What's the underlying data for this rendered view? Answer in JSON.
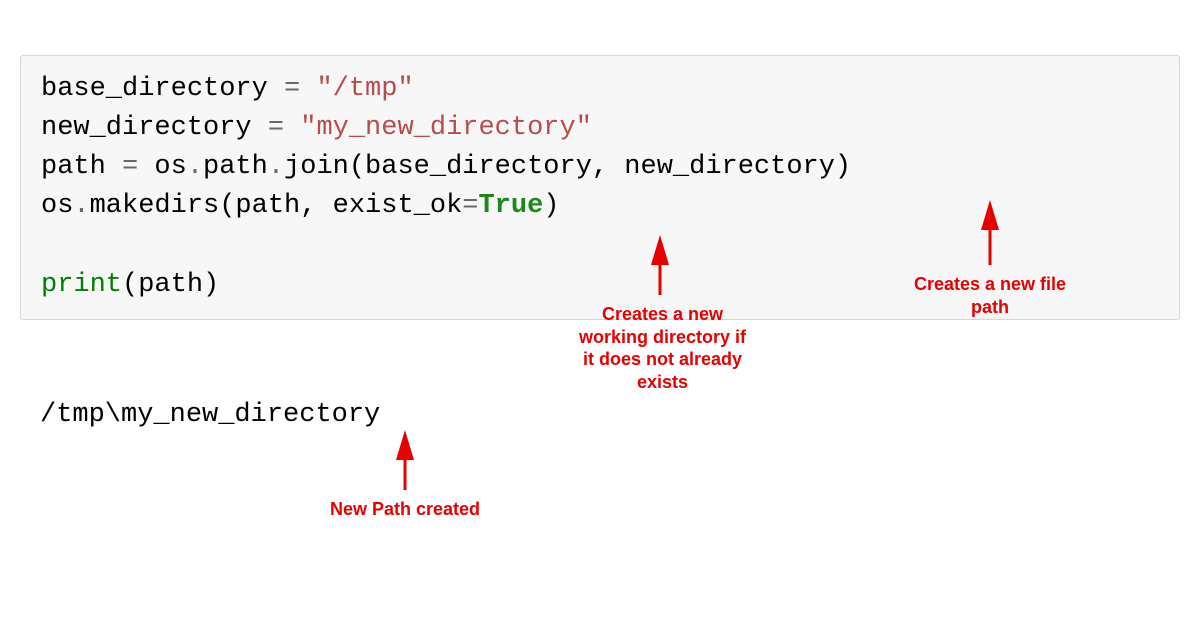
{
  "code": {
    "l1_var": "base_directory ",
    "l1_op": "=",
    "l1_str": " \"/tmp\"",
    "l2_var": "new_directory ",
    "l2_op": "=",
    "l2_str": " \"my_new_directory\"",
    "l3_a": "path ",
    "l3_op": "=",
    "l3_b": " os",
    "l3_dot1": ".",
    "l3_c": "path",
    "l3_dot2": ".",
    "l3_d": "join(base_directory, new_directory)",
    "l4_a": "os",
    "l4_dot": ".",
    "l4_b": "makedirs(path, exist_ok",
    "l4_eq": "=",
    "l4_true": "True",
    "l4_close": ")",
    "l5_fn": "print",
    "l5_args": "(path)"
  },
  "output": "/tmp\\my_new_directory",
  "annotations": {
    "a1": "Creates a new file\npath",
    "a2": "Creates a new\nworking directory if\nit does not already\nexists",
    "a3": "New Path created"
  },
  "colors": {
    "annotation": "#e60000",
    "code_bg": "#f7f7f7"
  }
}
